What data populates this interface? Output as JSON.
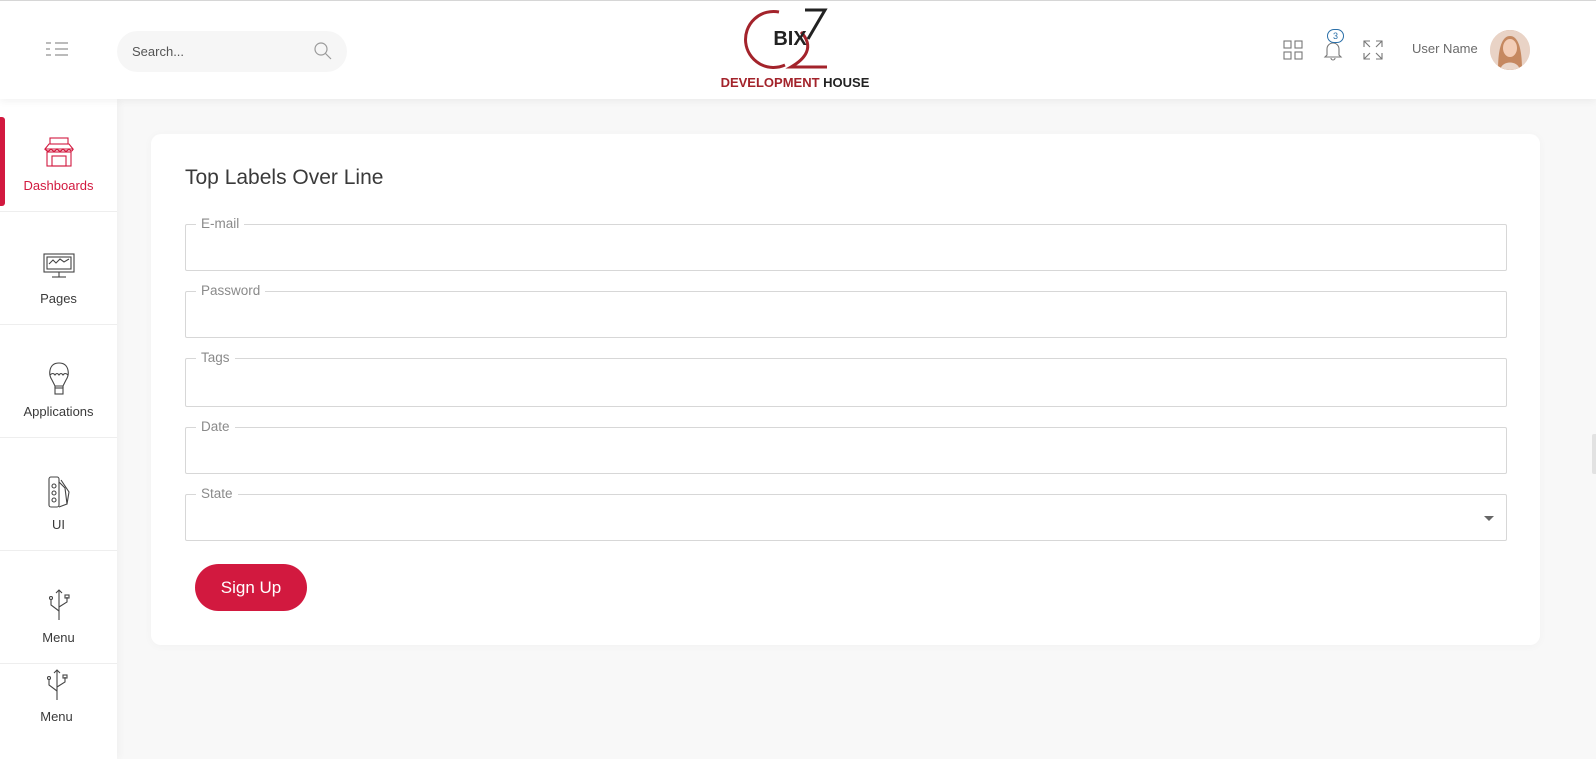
{
  "header": {
    "search_placeholder": "Search...",
    "logo": {
      "mark": "BIX",
      "word_red": "DEVELOPMENT",
      "word_dark": "HOUSE"
    },
    "notification_count": "3",
    "user_name": "User Name",
    "icons": [
      "menu-toggle-icon",
      "search-icon",
      "apps-grid-icon",
      "bell-icon",
      "fullscreen-icon"
    ]
  },
  "sidebar": {
    "items": [
      {
        "label": "Dashboards",
        "icon": "shop-icon",
        "active": true
      },
      {
        "label": "Pages",
        "icon": "monitor-icon",
        "active": false
      },
      {
        "label": "Applications",
        "icon": "balloon-icon",
        "active": false
      },
      {
        "label": "UI",
        "icon": "swatches-icon",
        "active": false
      },
      {
        "label": "Menu",
        "icon": "usb-icon",
        "active": false
      },
      {
        "label": "Menu",
        "icon": "usb-icon",
        "active": false
      }
    ]
  },
  "form": {
    "title": "Top Labels Over Line",
    "fields": [
      {
        "label": "E-mail",
        "value": ""
      },
      {
        "label": "Password",
        "value": ""
      },
      {
        "label": "Tags",
        "value": ""
      },
      {
        "label": "Date",
        "value": ""
      },
      {
        "label": "State",
        "value": ""
      }
    ],
    "submit_label": "Sign Up"
  },
  "colors": {
    "accent": "#d2193f",
    "logo_red": "#a3232b",
    "background": "#f8f8f8"
  }
}
